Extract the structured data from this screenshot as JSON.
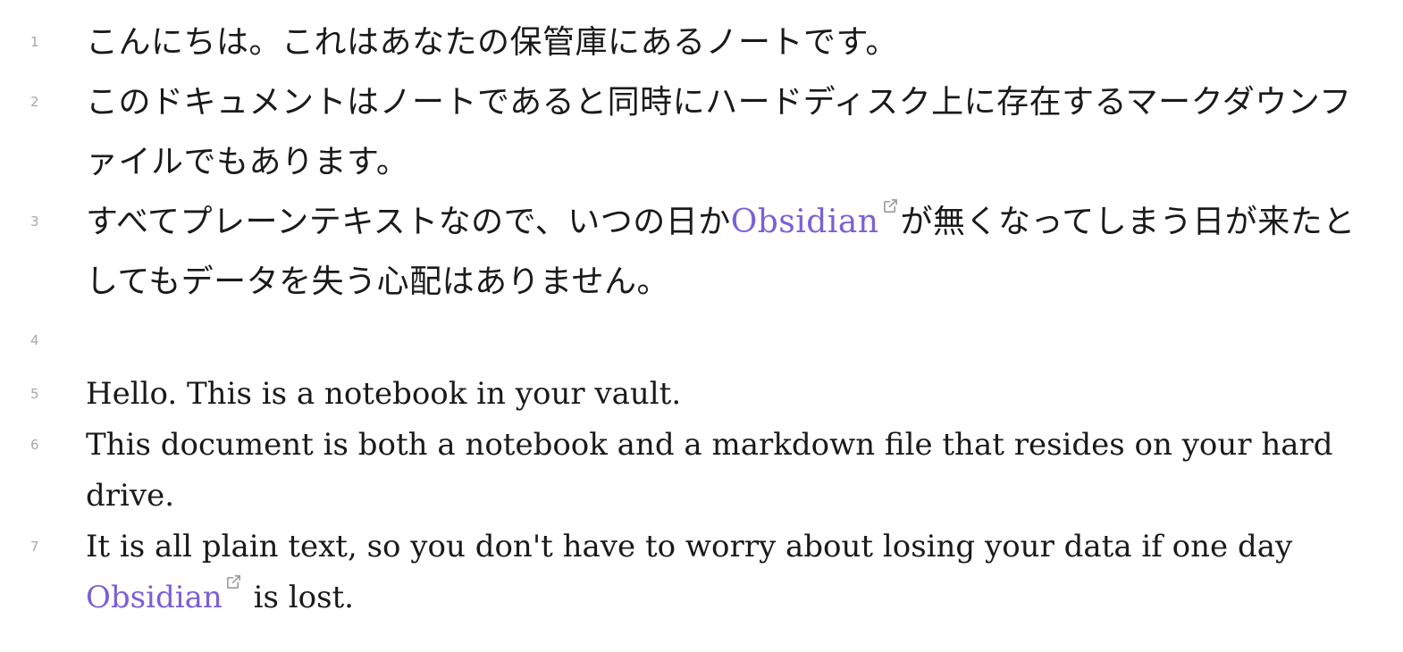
{
  "lines": [
    {
      "num": "1",
      "text": "こんにちは。これはあなたの保管庫にあるノートです。"
    },
    {
      "num": "2",
      "text": "このドキュメントはノートであると同時にハードディスク上に存在するマークダウンファイルでもあります。"
    },
    {
      "num": "3",
      "before": "すべてプレーンテキストなので、いつの日か",
      "link": "Obsidian",
      "after": "が無くなってしまう日が来たとしてもデータを失う心配はありません。"
    },
    {
      "num": "4",
      "text": ""
    },
    {
      "num": "5",
      "text": "Hello. This is a notebook in your vault."
    },
    {
      "num": "6",
      "text": "This document is both a notebook and a markdown file that resides on your hard drive."
    },
    {
      "num": "7",
      "before": "It is all plain text, so you don't have to worry about losing your data if one day ",
      "link": "Obsidian",
      "after": " is lost."
    }
  ],
  "icons": {
    "external_link": "external-link-icon"
  },
  "colors": {
    "link": "#7b5fd8",
    "line_number": "#a8a8a8",
    "text": "#1a1a1a",
    "background": "#ffffff"
  }
}
